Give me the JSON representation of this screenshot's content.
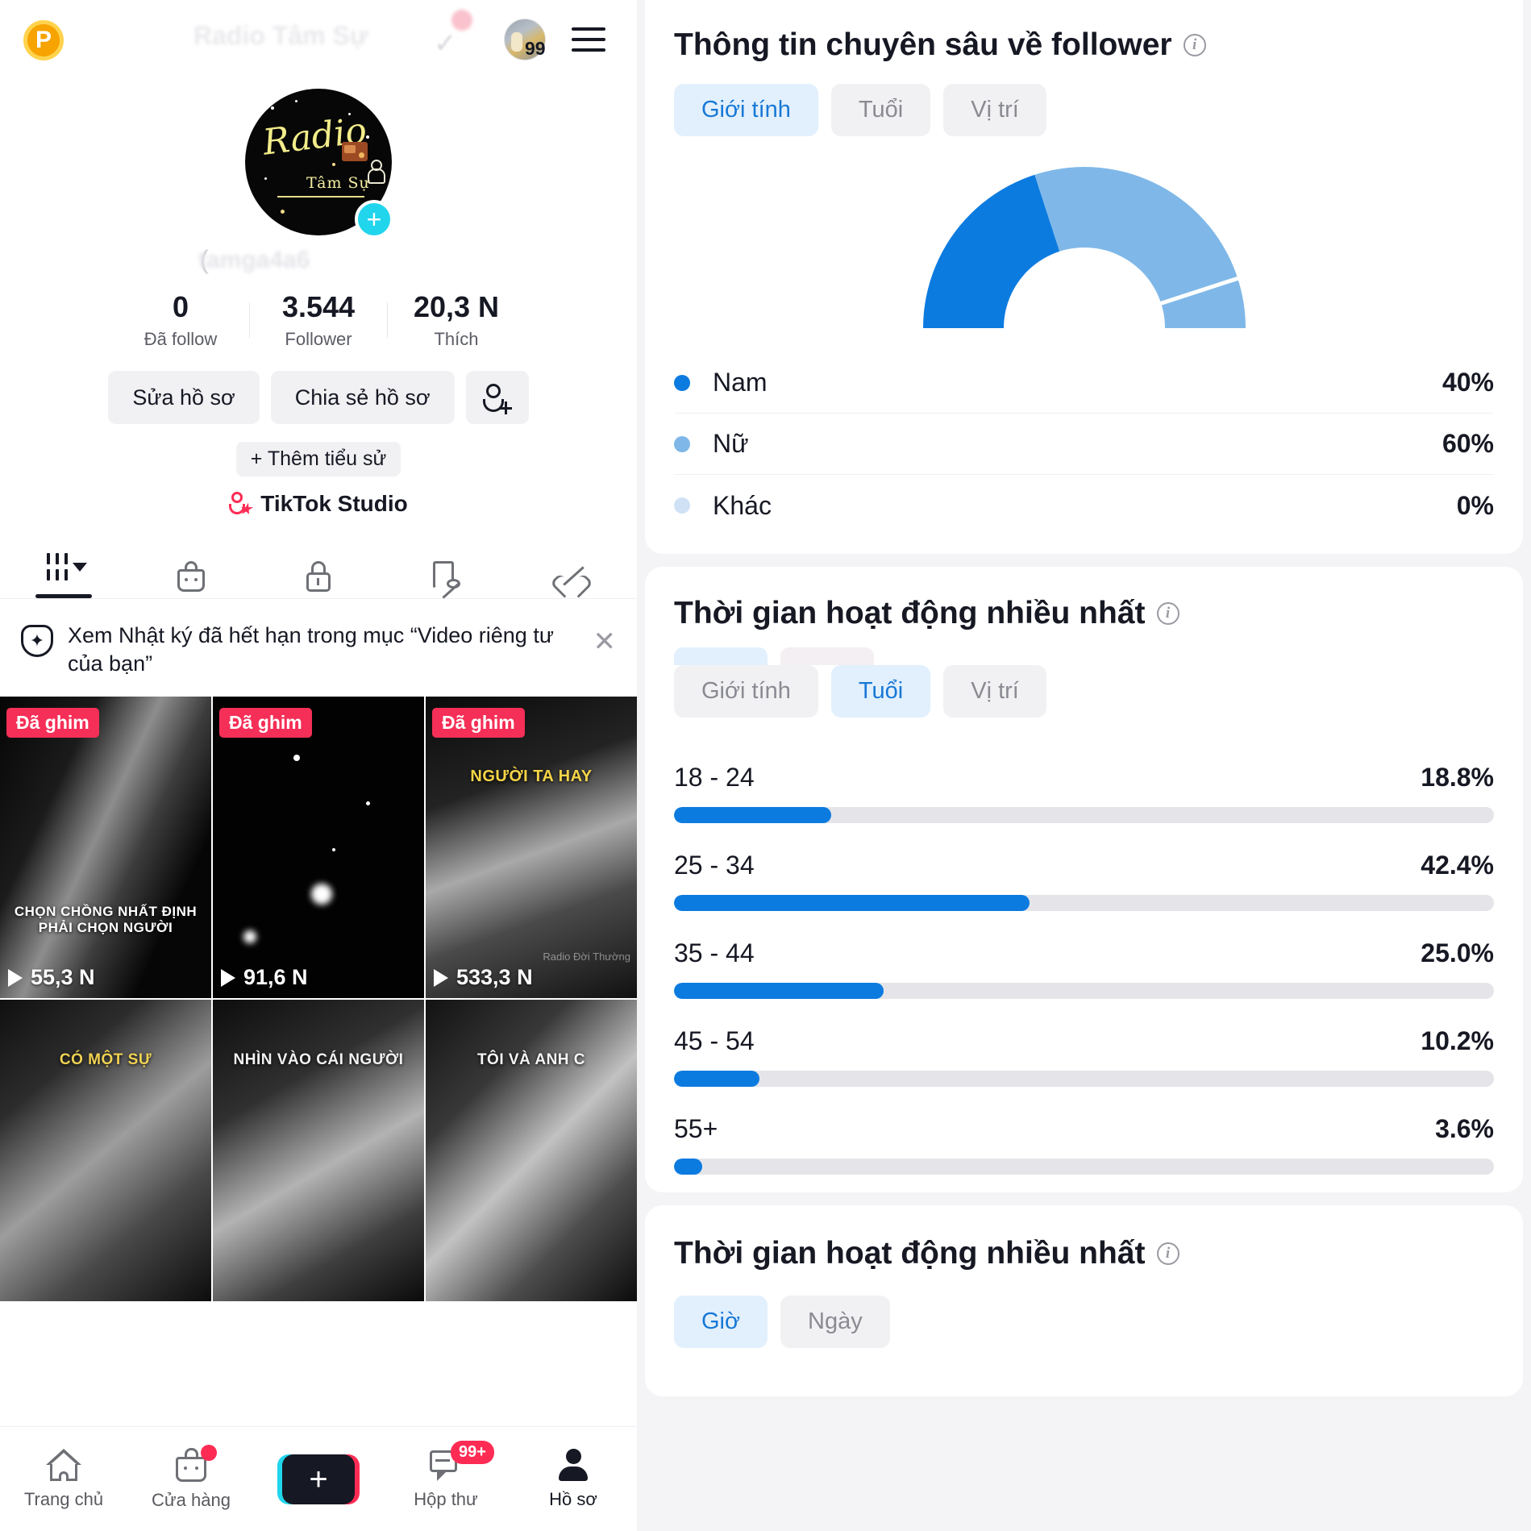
{
  "left": {
    "topbar": {
      "coin_label": "P",
      "ghost_title": "Radio Tâm Sự",
      "avatar_badge": "99",
      "menu_icon": "hamburger-menu-icon"
    },
    "profile": {
      "avatar_logo_word": "Radio",
      "avatar_logo_sub": "Tâm Sự",
      "handle_ghost": "tamga4a6",
      "plus_label": "+"
    },
    "stats": [
      {
        "num": "0",
        "label": "Đã follow"
      },
      {
        "num": "3.544",
        "label": "Follower"
      },
      {
        "num": "20,3 N",
        "label": "Thích"
      }
    ],
    "actions": {
      "edit": "Sửa hồ sơ",
      "share": "Chia sẻ hồ sơ",
      "add_friend_icon": "add-user-icon"
    },
    "bio_button": "+ Thêm tiểu sử",
    "studio_link": "TikTok Studio",
    "tabs": [
      {
        "icon": "grid-videos-icon",
        "active": true
      },
      {
        "icon": "shopping-bag-icon",
        "active": false
      },
      {
        "icon": "lock-private-icon",
        "active": false
      },
      {
        "icon": "bookmark-hidden-icon",
        "active": false
      },
      {
        "icon": "heart-hidden-icon",
        "active": false
      }
    ],
    "notice": {
      "icon": "add-to-story-icon",
      "text": "Xem Nhật ký đã hết hạn trong mục “Video riêng tư của bạn”",
      "close_icon": "close-icon"
    },
    "videos": [
      {
        "pin": "Đã ghim",
        "views": "55,3 N",
        "caption": "CHỌN CHỒNG NHẤT ĐỊNH PHẢI CHỌN NGƯỜI"
      },
      {
        "pin": "Đã ghim",
        "views": "91,6 N",
        "caption": ""
      },
      {
        "pin": "Đã ghim",
        "views": "533,3 N",
        "caption": "NGƯỜI TA HAY"
      },
      {
        "pin": "",
        "views": "",
        "caption": "CÓ MỘT SỰ"
      },
      {
        "pin": "",
        "views": "",
        "caption": "NHÌN VÀO CÁI NGƯỜI"
      },
      {
        "pin": "",
        "views": "",
        "caption": "TÔI VÀ ANH C"
      }
    ],
    "bottom_nav": [
      {
        "icon": "home-icon",
        "label": "Trang chủ",
        "badge": "",
        "active": false
      },
      {
        "icon": "shop-bag-icon",
        "label": "Cửa hàng",
        "badge": "",
        "active": false
      },
      {
        "icon": "create-plus-icon",
        "label": "",
        "badge": "",
        "active": false
      },
      {
        "icon": "inbox-icon",
        "label": "Hộp thư",
        "badge": "99+",
        "active": false
      },
      {
        "icon": "profile-person-icon",
        "label": "Hồ sơ",
        "badge": "",
        "active": true
      }
    ]
  },
  "right": {
    "follower_card": {
      "title": "Thông tin chuyên sâu về follower",
      "info_icon": "info-icon",
      "chips": [
        {
          "label": "Giới tính",
          "active": true
        },
        {
          "label": "Tuổi",
          "active": false
        },
        {
          "label": "Vị trí",
          "active": false
        }
      ]
    },
    "activity_card": {
      "title": "Thời gian hoạt động nhiều nhất",
      "info_icon": "info-icon",
      "chips": [
        {
          "label": "Giới tính",
          "active": false
        },
        {
          "label": "Tuổi",
          "active": true
        },
        {
          "label": "Vị trí",
          "active": false
        }
      ]
    },
    "hours_card": {
      "title": "Thời gian hoạt động nhiều nhất",
      "info_icon": "info-icon",
      "chips": [
        {
          "label": "Giờ",
          "active": true
        },
        {
          "label": "Ngày",
          "active": false
        }
      ]
    }
  },
  "chart_data": [
    {
      "type": "pie",
      "title": "Thông tin chuyên sâu về follower",
      "subtitle": "Giới tính",
      "shape": "semicircle-donut",
      "legend_position": "below",
      "labels": [
        "Nam",
        "Nữ",
        "Khác"
      ],
      "values": [
        40,
        60,
        0
      ],
      "value_labels": [
        "40%",
        "60%",
        "0%"
      ],
      "colors": [
        "#0C7BE0",
        "#7FB8E8",
        "#CFE2F5"
      ]
    },
    {
      "type": "bar",
      "orientation": "horizontal",
      "title": "Thời gian hoạt động nhiều nhất",
      "subtitle": "Tuổi",
      "categories": [
        "18 - 24",
        "25 - 34",
        "35 - 44",
        "45 - 54",
        "55+"
      ],
      "values": [
        18.8,
        42.4,
        25.0,
        10.2,
        3.6
      ],
      "value_labels": [
        "18.8%",
        "42.4%",
        "25.0%",
        "10.2%",
        "3.6%"
      ],
      "xlabel": "",
      "ylabel": "",
      "xlim": [
        0,
        42.4
      ],
      "grid": false,
      "bar_color": "#0C7BE0",
      "track_color": "#E5E5E9"
    }
  ]
}
